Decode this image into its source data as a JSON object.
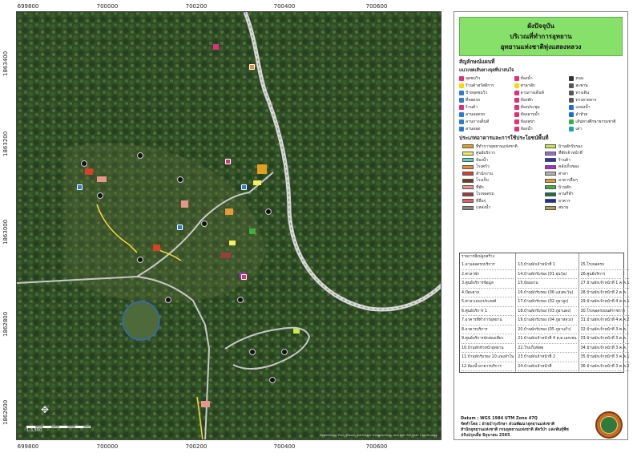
{
  "coords": {
    "top": [
      "699800",
      "700000",
      "700200",
      "700400",
      "700600"
    ],
    "bottom": [
      "699800",
      "700000",
      "700200",
      "700400",
      "700600"
    ],
    "left": [
      "1863400",
      "1863200",
      "1863000",
      "1862800",
      "1862600"
    ]
  },
  "title": {
    "line1": "ผังปัจจุบัน",
    "line2": "บริเวณที่ทำการอุทยาน",
    "line3": "อุทยานแห่งชาติทุ่งแสลงหลวง"
  },
  "legend": {
    "section1": "สัญลักษณ์แผนที่",
    "section1b": "แนวเขตเส้นทางจุดที่น่าสนใจ",
    "symbols": [
      {
        "label": "จุดชมวิว",
        "color": "#e0307a"
      },
      {
        "label": "ห้องน้ำ",
        "color": "#e0307a"
      },
      {
        "label": "ถนน",
        "color": "#333333"
      },
      {
        "label": "ร้านค้าสวัสดิการ",
        "color": "#ffd700"
      },
      {
        "label": "ศาลาพัก",
        "color": "#ffd700"
      },
      {
        "label": "สะพาน",
        "color": "#555555"
      },
      {
        "label": "ป้ายจุดชมวิว",
        "color": "#2c7bd6"
      },
      {
        "label": "ลานกางเต็นท์",
        "color": "#e0307a"
      },
      {
        "label": "ทางเดิน",
        "color": "#555555"
      },
      {
        "label": "ที่จอดรถ",
        "color": "#2c7bd6"
      },
      {
        "label": "ห้องพัก",
        "color": "#e0307a"
      },
      {
        "label": "ทางลาดยาง",
        "color": "#555555"
      },
      {
        "label": "ร้านค้า",
        "color": "#e0307a"
      },
      {
        "label": "ห้องประชุม",
        "color": "#e0307a"
      },
      {
        "label": "แหล่งน้ำ",
        "color": "#1a6fd0"
      },
      {
        "label": "ลานจอดรถ",
        "color": "#2c7bd6"
      },
      {
        "label": "ห้องอาบน้ำ",
        "color": "#e0307a"
      },
      {
        "label": "ลำห้วย",
        "color": "#1a6fd0"
      },
      {
        "label": "ลานกางเต็นท์",
        "color": "#2c7bd6"
      },
      {
        "label": "ห้องสุขา",
        "color": "#e0307a"
      },
      {
        "label": "เส้นทางศึกษาธรรมชาติ",
        "color": "#3cb043"
      },
      {
        "label": "ลานจอด",
        "color": "#2c7bd6"
      },
      {
        "label": "ห้องน้ำ",
        "color": "#e0307a"
      },
      {
        "label": "เสา",
        "color": "#1ba7a0"
      }
    ],
    "section2": "ประเภทอาคารและการใช้ประโยชน์พื้นที่",
    "building_types": [
      {
        "label": "ที่ทำการอุทยานแห่งชาติ",
        "color": "#e3a020"
      },
      {
        "label": "บ้านพักรับรอง",
        "color": "#c7e84a"
      },
      {
        "label": "ศูนย์บริการ",
        "color": "#f5ef5a"
      },
      {
        "label": "ที่พักเจ้าหน้าที่",
        "color": "#9b6fd6"
      },
      {
        "label": "ห้องน้ำ",
        "color": "#59d4d0"
      },
      {
        "label": "ร้านค้า",
        "color": "#2a2fd0"
      },
      {
        "label": "โรงครัว",
        "color": "#f08a2c"
      },
      {
        "label": "คลังเก็บของ",
        "color": "#b02ad0"
      },
      {
        "label": "สำนักงาน",
        "color": "#d8402a"
      },
      {
        "label": "ศาลา",
        "color": "#b0b0b0"
      },
      {
        "label": "โรงเก็บ",
        "color": "#7a3b1a"
      },
      {
        "label": "อาคารอื่นๆ",
        "color": "#e79c3a"
      },
      {
        "label": "ที่พัก",
        "color": "#e8958a"
      },
      {
        "label": "บ้านพัก",
        "color": "#3cb043"
      },
      {
        "label": "โรงจอดรถ",
        "color": "#9b3d3d"
      },
      {
        "label": "ลานกีฬา",
        "color": "#1a6e4a"
      },
      {
        "label": "ที่อื่นๆ",
        "color": "#e45c5c"
      },
      {
        "label": "อาคาร",
        "color": "#1a2fa0"
      },
      {
        "label": "แหล่งน้ำ",
        "color": "#888888"
      },
      {
        "label": "สนาม",
        "color": "#b0a14a"
      }
    ],
    "building_table_header": "รายการสิ่งปลูกสร้าง",
    "building_table": [
      [
        "1.ลานจอดรถบริการ",
        "13.บ้านพักเจ้าหน้าที่ 1",
        "25.โรงจอดรถ"
      ],
      [
        "2.ศาลาพัก",
        "14.บ้านพักรับรอง (01 อุ่นวุ้น)",
        "26.ศูนย์บริการ"
      ],
      [
        "3.ศูนย์บริการข้อมูล",
        "15.ป้อมยาม",
        "27.บ้านพักเจ้าหน้าที่ 1 ค.ค.1"
      ],
      [
        "4.ป้อมยาม",
        "16.บ้านพักรับรอง (06 แสงตะวัน)",
        "28.บ้านพักเจ้าหน้าที่ 2 ค.ค."
      ],
      [
        "5.ศาลาเอนกประสงค์",
        "17.บ้านพักรับรอง (02 ภูผาสูง)",
        "29.บ้านพักเจ้าหน้าที่ 4 ค.ค.1"
      ],
      [
        "6.ศูนย์บริการ 1",
        "18.บ้านพักรับรอง (03 ภูผาแดง)",
        "30.โรงจอดรถยนต์ราชการ"
      ],
      [
        "7.อาคารที่ทำการอุทยาน",
        "19.บ้านพักรับรอง (04 ภูผาหลวง)",
        "31.บ้านพักเจ้าหน้าที่ 4 ค.ค.2"
      ],
      [
        "8.อาคารบริการ",
        "20.บ้านพักรับรอง (05 ภูผาแก้ว)",
        "32.บ้านพักเจ้าหน้าที่ 3 ค.ค."
      ],
      [
        "9.ศูนย์บริการนักท่องเที่ยว",
        "21.บ้านพักเจ้าหน้าที่ 4 ค.ค.เอกเชน",
        "33.บ้านพักเจ้าหน้าที่ 3 ค.ค."
      ],
      [
        "10.บ้านพักหัวหน้าอุทยาน",
        "22.โรงเก็บพัสดุ",
        "34.บ้านพักเจ้าหน้าที่ 3 ค.ค."
      ],
      [
        "11.บ้านพักรับรอง 10 แพงลำโพ",
        "23.บ้านพักเจ้าหน้าที่ 2",
        "35.บ้านพักเจ้าหน้าที่ 3 ค.ค.1"
      ],
      [
        "12.ห้องน้ำอาคารบริการ",
        "24.บ้านพักเจ้าหน้าที่",
        "36.บ้านพักเจ้าหน้าที่ 3 ค.ค.2"
      ]
    ],
    "datum": "Datum : WGS 1984 UTM Zone 47Q",
    "made_by": "จัดทำโดย : ฝ่ายบำรุงรักษา ส่วนพัฒนาอุทยานแห่งชาติ",
    "office": "สำนักอุทยานแห่งชาติ กรมอุทยานแห่งชาติ สัตว์ป่า และพันธุ์พืช",
    "updated": "ปรับปรุงเมื่อ มิถุนายน 2565"
  },
  "map": {
    "scale": "1:3,500",
    "attribution": "Powered by Esri, Maxar, Earthstar Geographics, and the GIS User Community"
  }
}
